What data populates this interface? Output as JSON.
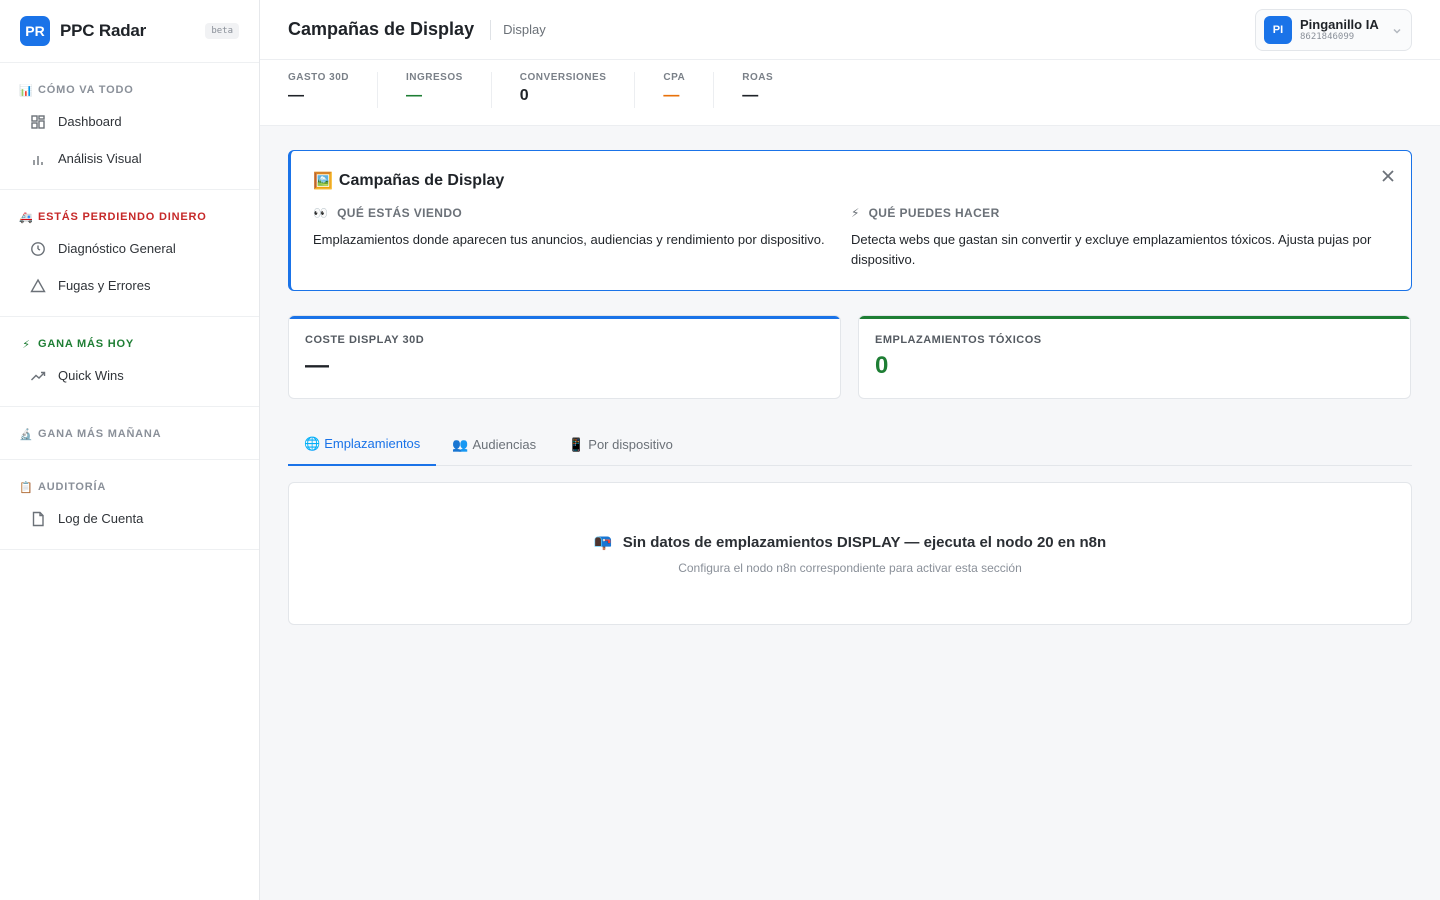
{
  "brand": {
    "logo": "PR",
    "name": "PPC Radar",
    "badge": "beta"
  },
  "sidebar": {
    "sections": [
      {
        "emoji": "📊",
        "title": "CÓMO VA TODO",
        "color": "#8a9099",
        "items": [
          {
            "label": "Dashboard",
            "icon": "grid-icon"
          },
          {
            "label": "Análisis Visual",
            "icon": "bar-chart-icon"
          }
        ]
      },
      {
        "emoji": "🚑",
        "title": "ESTÁS PERDIENDO DINERO",
        "color": "#c62828",
        "items": [
          {
            "label": "Diagnóstico General",
            "icon": "clock-icon"
          },
          {
            "label": "Fugas y Errores",
            "icon": "warning-icon"
          }
        ]
      },
      {
        "emoji": "⚡",
        "title": "GANA MÁS HOY",
        "color": "#1e7e34",
        "items": [
          {
            "label": "Quick Wins",
            "icon": "trend-up-icon"
          }
        ]
      },
      {
        "emoji": "🔬",
        "title": "GANA MÁS MAÑANA",
        "color": "#8a9099",
        "items": []
      },
      {
        "emoji": "📋",
        "title": "AUDITORÍA",
        "color": "#8a9099",
        "items": [
          {
            "label": "Log de Cuenta",
            "icon": "document-icon"
          }
        ]
      }
    ]
  },
  "header": {
    "title": "Campañas de Display",
    "crumb": "Display",
    "account": {
      "initials": "PI",
      "name": "Pinganillo IA",
      "id": "8621846099"
    }
  },
  "kpis": [
    {
      "label": "GASTO 30D",
      "value": "—",
      "color": "#1f2328"
    },
    {
      "label": "INGRESOS",
      "value": "—",
      "color": "#1e7e34"
    },
    {
      "label": "CONVERSIONES",
      "value": "0",
      "color": "#1f2328"
    },
    {
      "label": "CPA",
      "value": "—",
      "color": "#e8710a"
    },
    {
      "label": "ROAS",
      "value": "—",
      "color": "#1f2328"
    }
  ],
  "banner": {
    "emoji": "🖼️",
    "title": "Campañas de Display",
    "left": {
      "emoji": "👀",
      "heading": "QUÉ ESTÁS VIENDO",
      "text": "Emplazamientos donde aparecen tus anuncios, audiencias y rendimiento por dispositivo."
    },
    "right": {
      "emoji": "⚡",
      "heading": "QUÉ PUEDES HACER",
      "text": "Detecta webs que gastan sin convertir y excluye emplazamientos tóxicos. Ajusta pujas por dispositivo."
    }
  },
  "stats": {
    "cost": {
      "label": "COSTE DISPLAY 30D",
      "value": "—",
      "accent": "#1a73e8"
    },
    "toxic": {
      "label": "EMPLAZAMIENTOS TÓXICOS",
      "value": "0",
      "accent": "#1e7e34"
    }
  },
  "tabs": [
    {
      "emoji": "🌐",
      "label": "Emplazamientos",
      "active": true
    },
    {
      "emoji": "👥",
      "label": "Audiencias",
      "active": false
    },
    {
      "emoji": "📱",
      "label": "Por dispositivo",
      "active": false
    }
  ],
  "empty": {
    "emoji": "📭",
    "title": "Sin datos de emplazamientos DISPLAY — ejecuta el nodo 20 en n8n",
    "subtitle": "Configura el nodo n8n correspondiente para activar esta sección"
  }
}
